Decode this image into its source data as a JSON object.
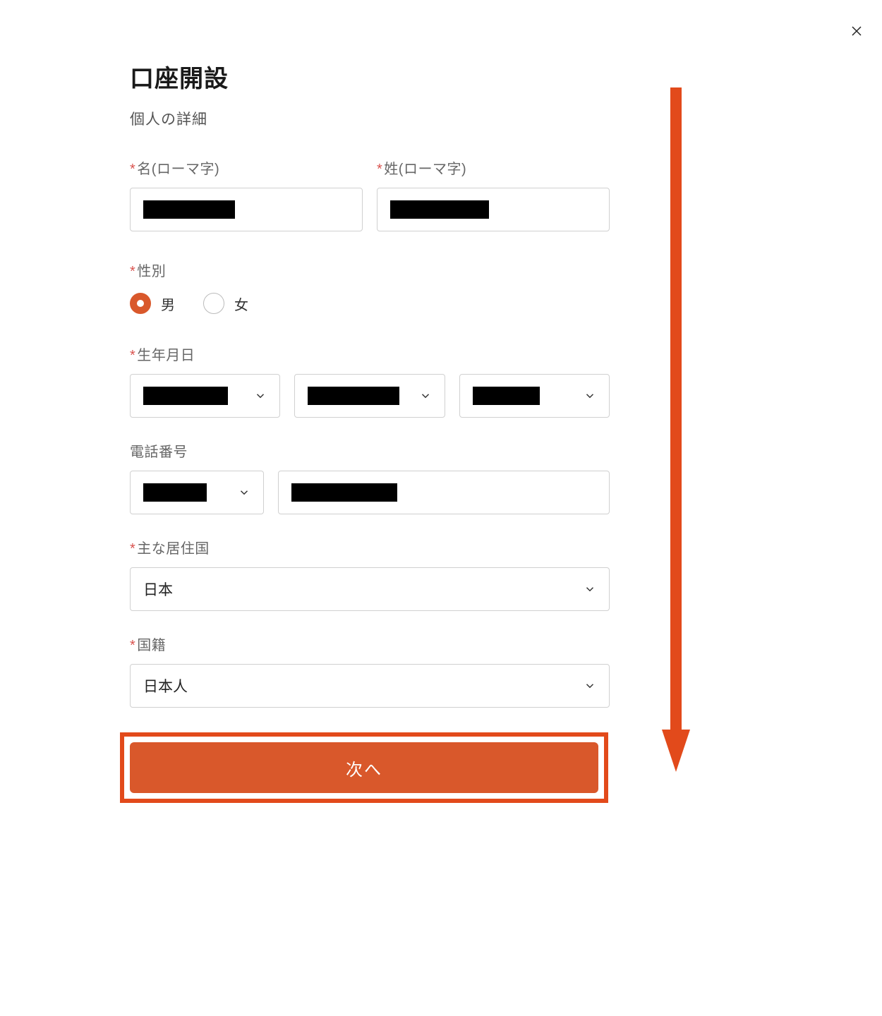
{
  "header": {
    "title": "口座開設",
    "subtitle": "個人の詳細"
  },
  "labels": {
    "first_name": "名(ローマ字)",
    "last_name": "姓(ローマ字)",
    "gender": "性別",
    "dob": "生年月日",
    "phone": "電話番号",
    "residence": "主な居住国",
    "nationality": "国籍",
    "required_mark": "*"
  },
  "gender_options": {
    "male": "男",
    "female": "女"
  },
  "residence_value": "日本",
  "nationality_value": "日本人",
  "buttons": {
    "next": "次へ"
  },
  "colors": {
    "accent": "#d9582b",
    "highlight_border": "#e24a1b"
  }
}
